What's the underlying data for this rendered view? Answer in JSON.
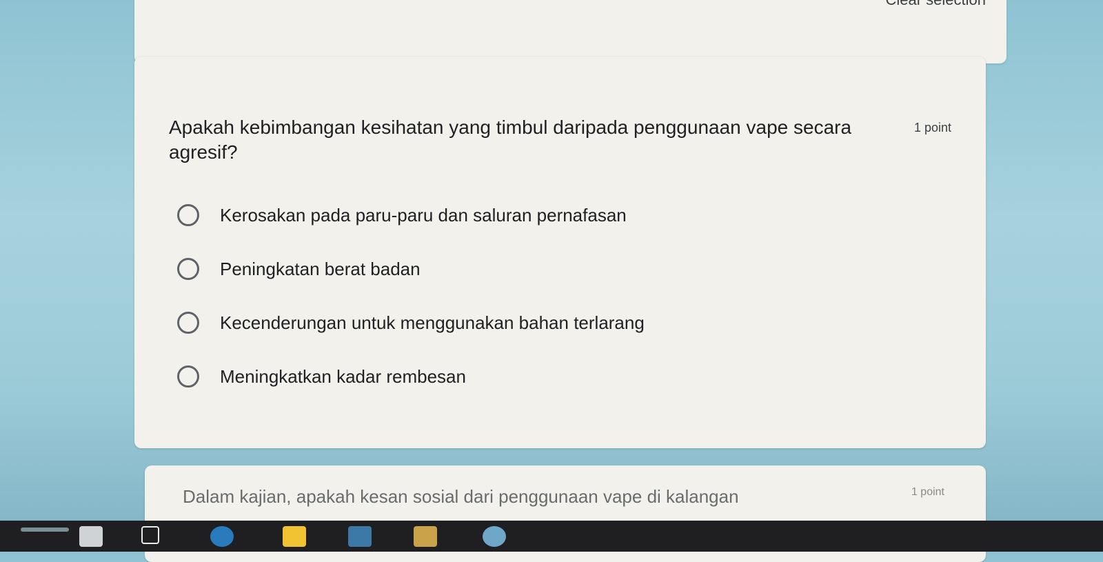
{
  "prev_card": {
    "clear_label": "Clear selection"
  },
  "question": {
    "title": "Apakah kebimbangan kesihatan yang timbul daripada penggunaan vape secara agresif?",
    "points": "1 point",
    "options": [
      {
        "label": "Kerosakan pada paru-paru dan saluran pernafasan"
      },
      {
        "label": "Peningkatan berat badan"
      },
      {
        "label": "Kecenderungan untuk menggunakan bahan terlarang"
      },
      {
        "label": "Meningkatkan kadar rembesan"
      }
    ]
  },
  "next_question": {
    "title": "Dalam kajian, apakah kesan sosial dari penggunaan vape di kalangan",
    "points": "1 point"
  },
  "colors": {
    "card_bg": "#f3f1ec",
    "radio_border": "#5f6368",
    "taskbar": "#1f1f22"
  },
  "taskbar": {
    "icons": [
      "launcher-icon",
      "files-icon",
      "chrome-icon",
      "notes-icon",
      "gmail-icon",
      "drive-icon",
      "edge-icon"
    ]
  }
}
